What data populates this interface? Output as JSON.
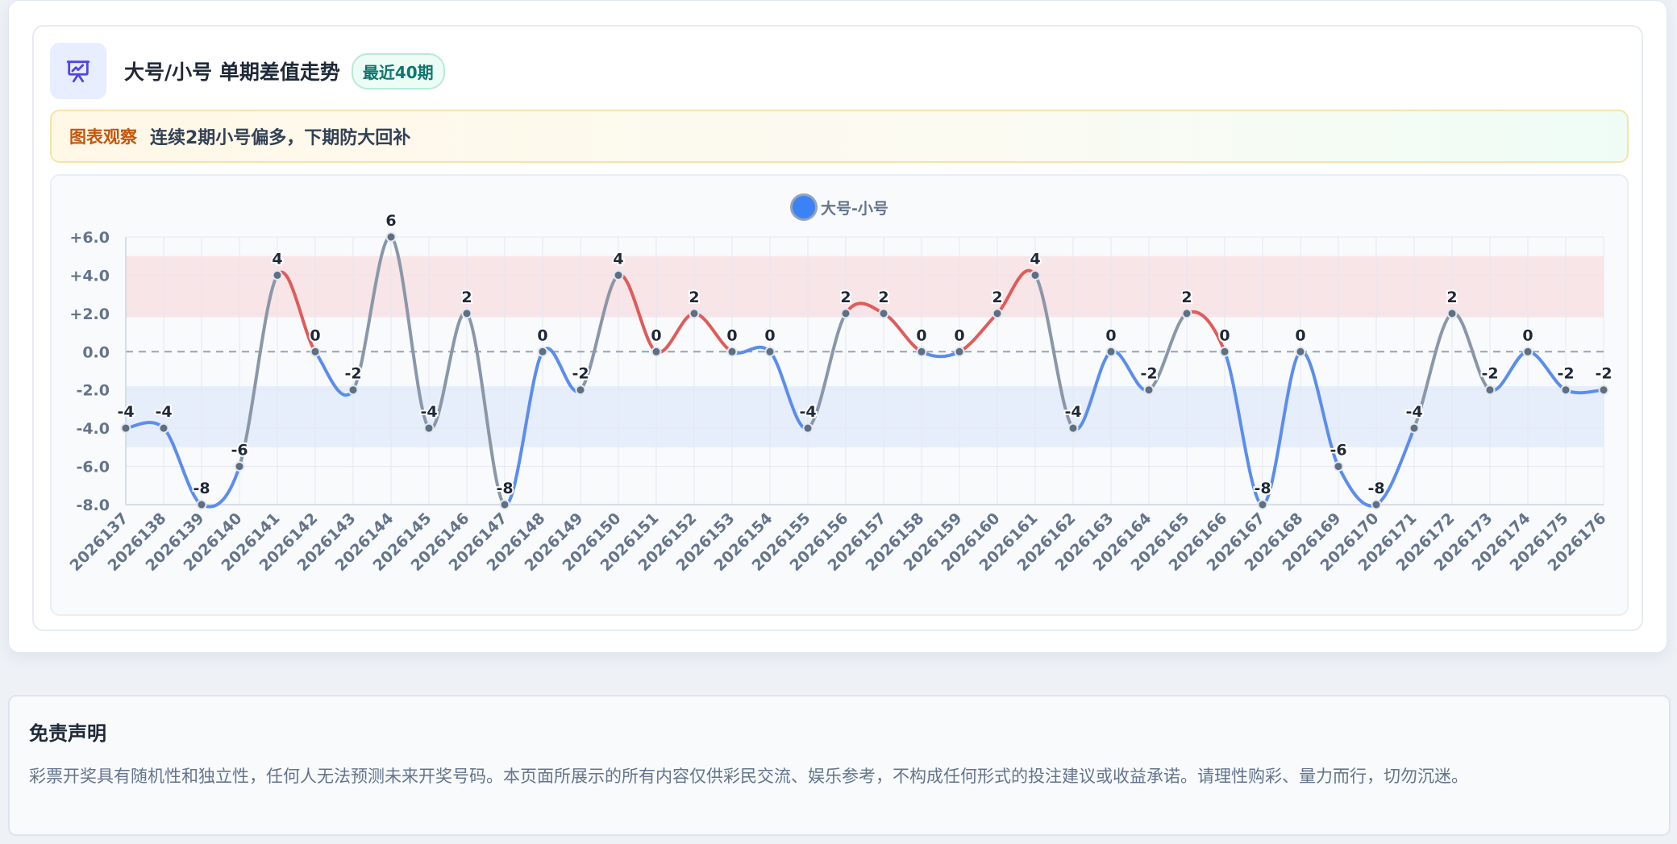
{
  "card": {
    "title": "大号/小号 单期差值走势",
    "badge": "最近40期",
    "icon": "presentation-chart-icon",
    "observe_label": "图表观察",
    "observe_text": "连续2期小号偏多，下期防大回补"
  },
  "disclaimer": {
    "title": "免责声明",
    "text": "彩票开奖具有随机性和独立性，任何人无法预测未来开奖号码。本页面所展示的所有内容仅供彩民交流、娱乐参考，不构成任何形式的投注建议或收益承诺。请理性购彩、量力而行，切勿沉迷。"
  },
  "colors": {
    "positive": "#e05b5b",
    "negative": "#5b8dee",
    "neutral": "#8a97a8",
    "accent": "#3b82f6"
  },
  "chart_data": {
    "type": "line",
    "series": [
      {
        "name": "大号-小号"
      }
    ],
    "categories": [
      "2026137",
      "2026138",
      "2026139",
      "2026140",
      "2026141",
      "2026142",
      "2026143",
      "2026144",
      "2026145",
      "2026146",
      "2026147",
      "2026148",
      "2026149",
      "2026150",
      "2026151",
      "2026152",
      "2026153",
      "2026154",
      "2026155",
      "2026156",
      "2026157",
      "2026158",
      "2026159",
      "2026160",
      "2026161",
      "2026162",
      "2026163",
      "2026164",
      "2026165",
      "2026166",
      "2026167",
      "2026168",
      "2026169",
      "2026170",
      "2026171",
      "2026172",
      "2026173",
      "2026174",
      "2026175",
      "2026176"
    ],
    "values": [
      -4,
      -4,
      -8,
      -6,
      4,
      0,
      -2,
      6,
      -4,
      2,
      -8,
      0,
      -2,
      4,
      0,
      2,
      0,
      0,
      -4,
      2,
      2,
      0,
      0,
      2,
      4,
      -4,
      0,
      -2,
      2,
      0,
      -8,
      0,
      -6,
      -8,
      -4,
      2,
      -2,
      0,
      -2,
      -2
    ],
    "ylim": [
      -8,
      6
    ],
    "yticks": [
      "+6.0",
      "+4.0",
      "+2.0",
      "0.0",
      "-2.0",
      "-4.0",
      "-6.0",
      "-8.0"
    ],
    "ytick_values": [
      6,
      4,
      2,
      0,
      -2,
      -4,
      -6,
      -8
    ],
    "bands": [
      {
        "from": 1.8,
        "to": 5,
        "color": "#f8e5e7"
      },
      {
        "from": -5,
        "to": -1.8,
        "color": "#e7eefb"
      }
    ],
    "zero_line": "dashed",
    "grid": true,
    "legend": "top-center"
  }
}
